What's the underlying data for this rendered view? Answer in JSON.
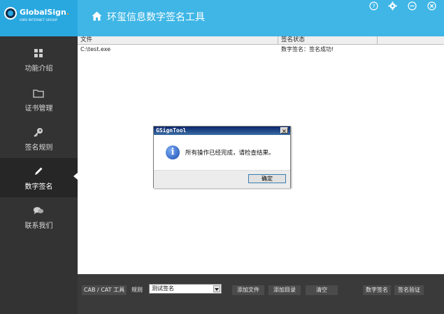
{
  "brand": {
    "name": "GlobalSign",
    "dot": ".",
    "subtitle": "GMO INTERNET GROUP",
    "accent": "#3fb6e6"
  },
  "header": {
    "title": "环玺信息数字签名工具",
    "window_buttons": [
      "help-icon",
      "settings-icon",
      "minimize-icon",
      "close-icon"
    ]
  },
  "sidebar": {
    "items": [
      {
        "label": "功能介绍",
        "icon": "grid-icon",
        "active": false
      },
      {
        "label": "证书管理",
        "icon": "folder-icon",
        "active": false
      },
      {
        "label": "签名规则",
        "icon": "key-icon",
        "active": false
      },
      {
        "label": "数字签名",
        "icon": "pen-icon",
        "active": true
      },
      {
        "label": "联系我们",
        "icon": "chat-icon",
        "active": false
      }
    ]
  },
  "table": {
    "columns": [
      "文件",
      "签名状态"
    ],
    "rows": [
      {
        "file": "C:\\test.exe",
        "status": "数字签名：签名成功!"
      }
    ]
  },
  "dialog": {
    "title": "GSignTool",
    "close": "×",
    "icon": "info-icon",
    "icon_glyph": "i",
    "message": "所有操作已经完成，请检查结果。",
    "ok_label": "确定"
  },
  "toolbar": {
    "cab_cat_label": "CAB / CAT 工具",
    "rule_label": "规则",
    "rule_value": "测试签名",
    "add_file": "添加文件",
    "add_dir": "添加目录",
    "clear": "清空",
    "sign": "数字签名",
    "verify": "签名验证"
  }
}
